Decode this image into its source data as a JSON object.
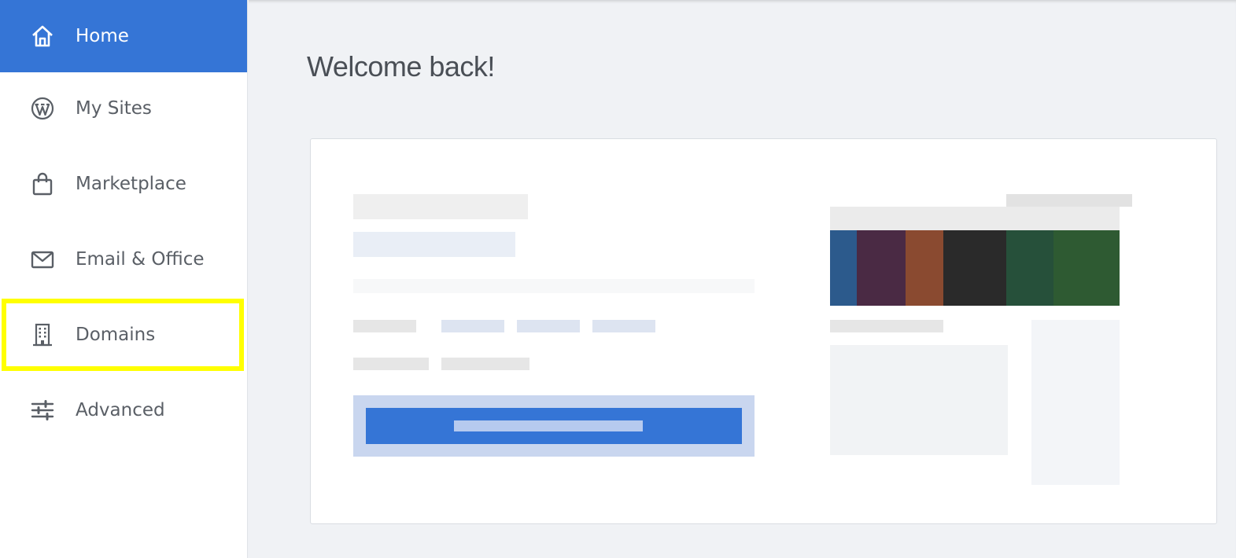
{
  "sidebar": {
    "items": [
      {
        "label": "Home",
        "icon": "home-icon",
        "active": true
      },
      {
        "label": "My Sites",
        "icon": "wordpress-icon"
      },
      {
        "label": "Marketplace",
        "icon": "shopping-bag-icon"
      },
      {
        "label": "Email & Office",
        "icon": "envelope-icon"
      },
      {
        "label": "Domains",
        "icon": "building-icon",
        "highlighted": true
      },
      {
        "label": "Advanced",
        "icon": "sliders-icon"
      }
    ]
  },
  "main": {
    "title": "Welcome back!"
  },
  "colors": {
    "accent": "#3575d6",
    "highlight": "#ffff00",
    "background": "#f0f2f5"
  }
}
